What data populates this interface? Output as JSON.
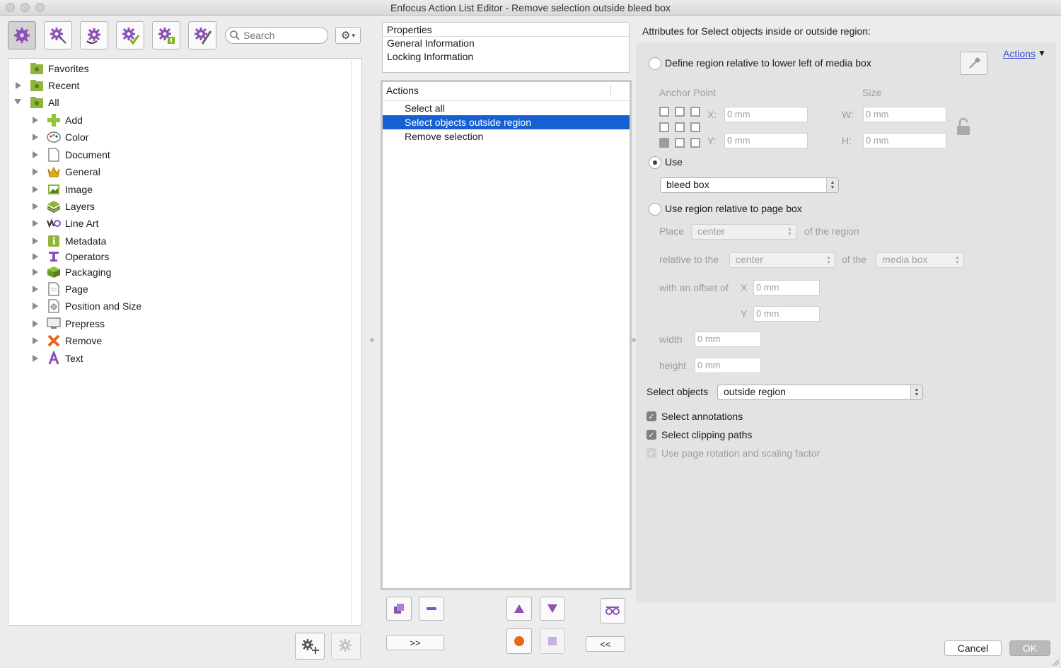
{
  "window": {
    "title": "Enfocus Action List Editor - Remove selection outside bleed box"
  },
  "toolbar": {
    "search_placeholder": "Search",
    "buttons": [
      "actions-gear-icon",
      "edit-gear-icon",
      "import-gear-icon",
      "check-gear-icon",
      "info-gear-icon",
      "settings-gear-icon"
    ]
  },
  "tree": {
    "top": [
      {
        "label": "Favorites",
        "icon": "favorites-folder-icon"
      },
      {
        "label": "Recent",
        "icon": "recent-folder-icon"
      },
      {
        "label": "All",
        "icon": "all-folder-icon"
      }
    ],
    "categories": [
      {
        "label": "Add",
        "icon": "plus-icon"
      },
      {
        "label": "Color",
        "icon": "palette-icon"
      },
      {
        "label": "Document",
        "icon": "document-icon"
      },
      {
        "label": "General",
        "icon": "crown-icon"
      },
      {
        "label": "Image",
        "icon": "image-icon"
      },
      {
        "label": "Layers",
        "icon": "layers-icon"
      },
      {
        "label": "Line Art",
        "icon": "line-art-icon"
      },
      {
        "label": "Metadata",
        "icon": "metadata-icon"
      },
      {
        "label": "Operators",
        "icon": "operators-icon"
      },
      {
        "label": "Packaging",
        "icon": "packaging-icon"
      },
      {
        "label": "Page",
        "icon": "page-icon"
      },
      {
        "label": "Position and Size",
        "icon": "position-icon"
      },
      {
        "label": "Prepress",
        "icon": "monitor-icon"
      },
      {
        "label": "Remove",
        "icon": "remove-x-icon"
      },
      {
        "label": "Text",
        "icon": "text-a-icon"
      }
    ]
  },
  "properties": {
    "header": "Properties",
    "items": [
      "General Information",
      "Locking Information"
    ]
  },
  "actions": {
    "header": "Actions",
    "items": [
      "Select all",
      "Select objects outside region",
      "Remove selection"
    ],
    "selected_index": 1,
    "move_right_label": ">>",
    "move_left_label": "<<"
  },
  "attributes": {
    "title": "Attributes for Select objects inside or outside region:",
    "actions_link": "Actions",
    "define_region_label": "Define region relative to lower left of media box",
    "anchor_point_label": "Anchor Point",
    "size_label": "Size",
    "x_label": "X:",
    "y_label": "Y:",
    "w_label": "W:",
    "h_label": "H:",
    "x_value": "0 mm",
    "y_value": "0 mm",
    "w_value": "0 mm",
    "h_value": "0 mm",
    "use_label": "Use",
    "use_box_value": "bleed box",
    "use_region_label": "Use region relative to page box",
    "place_label": "Place",
    "place_value": "center",
    "of_the_region_label": "of the region",
    "relative_to_label": "relative to the",
    "relative_value": "center",
    "of_the_label": "of the",
    "page_box_value": "media box",
    "offset_label": "with an offset of",
    "offset_x_label": "X",
    "offset_y_label": "Y",
    "offset_x_value": "0 mm",
    "offset_y_value": "0 mm",
    "width_label": "width",
    "height_label": "height",
    "width_value": "0 mm",
    "height_value": "0 mm",
    "select_objects_label": "Select objects",
    "select_objects_value": "outside region",
    "select_annotations_label": "Select annotations",
    "select_clipping_label": "Select clipping paths",
    "use_rotation_label": "Use page rotation and scaling factor",
    "selected_radio": "use"
  },
  "dialog": {
    "cancel_label": "Cancel",
    "ok_label": "OK"
  },
  "colors": {
    "selection": "#1661d2",
    "ok_button": "#b9b9b9",
    "link": "#3b4ed8",
    "purple_icon": "#8b4fb5"
  }
}
